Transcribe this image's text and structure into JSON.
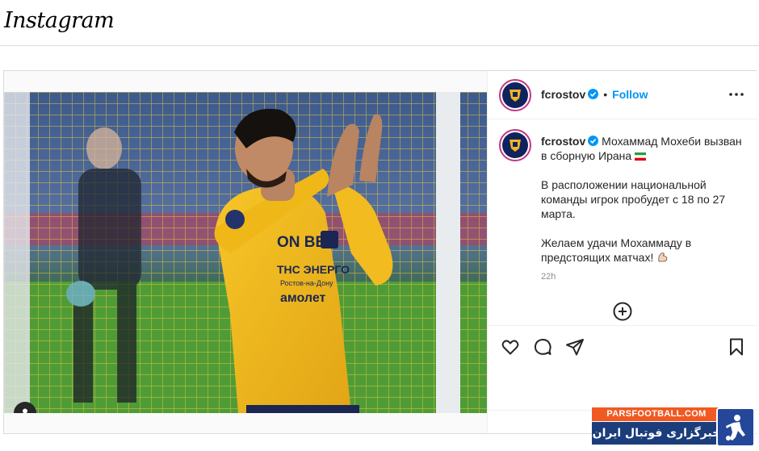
{
  "app": {
    "logo_text": "Instagram"
  },
  "post": {
    "author": "fcrostov",
    "follow_label": "Follow",
    "separator": "•",
    "caption": {
      "username": "fcrostov",
      "line1": "Мохаммад Мохеби вызван в сборную Ирана",
      "paragraph2": "В расположении национальной команды игрок пробудет с 18 по 27 марта.",
      "paragraph3": "Желаем удачи Мохаммаду в предстоящих матчах!"
    },
    "timestamp": "22h",
    "icons": {
      "like": "heart-icon",
      "comment": "comment-icon",
      "share": "send-icon",
      "save": "bookmark-icon",
      "more": "more-options-icon",
      "tags": "user-tag-icon",
      "add_comment": "plus-circle-icon",
      "verified": "verified-badge-icon"
    },
    "photo_text": {
      "sponsor1": "ON BET",
      "sponsor2": "ТНС ЭНЕРГО",
      "sponsor3": "Ростов-на-Дону",
      "sponsor4": "амолет"
    }
  },
  "watermark": {
    "site": "PARSFOOTBALL.COM",
    "tagline": "خبرگزاری فوتبال ایران"
  },
  "colors": {
    "follow": "#0095f6",
    "verified": "#0095f6",
    "jersey": "#f2b61c",
    "watermark_orange": "#f05a22",
    "watermark_blue": "#1c3d7c"
  }
}
